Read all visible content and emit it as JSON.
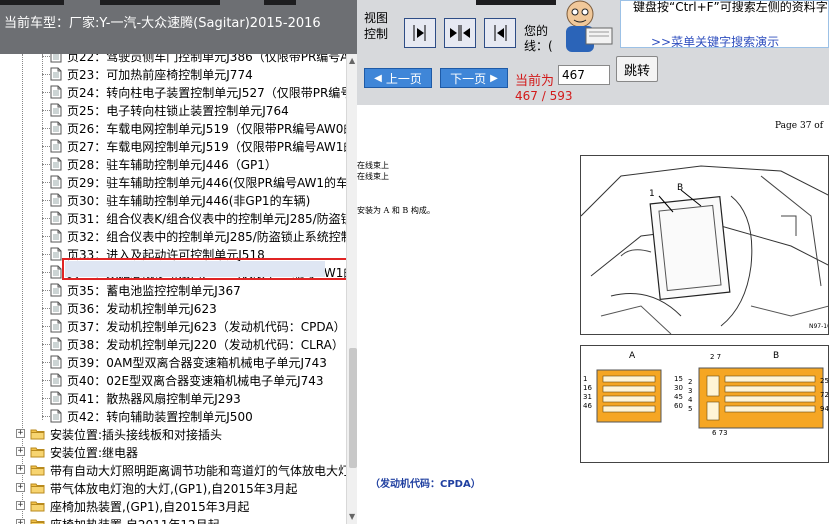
{
  "header": {
    "title": "当前车型：厂家:Y-一汽-大众速腾(Sagitar)2015-2016",
    "view_ctl": "视图控制",
    "tip_partial": "您的\n线：(",
    "help_text": "键盘按“Ctrl+F”可搜索左侧的资料字!",
    "help_link": ">>菜单关键字搜索演示"
  },
  "tree": {
    "pages": [
      {
        "label": "页22：驾驶员侧车门控制单元J386（仅限带PR编号A"
      },
      {
        "label": "页23：可加热前座椅控制单元J774"
      },
      {
        "label": "页24：转向柱电子装置控制单元J527（仅限带PR编号"
      },
      {
        "label": "页25：电子转向柱锁止装置控制单元J764"
      },
      {
        "label": "页26：车载电网控制单元J519（仅限带PR编号AW0的"
      },
      {
        "label": "页27：车载电网控制单元J519（仅限带PR编号AW1的"
      },
      {
        "label": "页28：驻车辅助控制单元J446（GP1）"
      },
      {
        "label": "页29：驻车辅助控制单元J446(仅限PR编号AW1的车"
      },
      {
        "label": "页30：驻车辅助控制单元J446(非GP1的车辆)"
      },
      {
        "label": "页31：组合仪表K/组合仪表中的控制单元J285/防盗锁"
      },
      {
        "label": "页32：组合仪表中的控制单元J285/防盗锁止系统控制"
      },
      {
        "label": "页33：进入及起动许可控制单元J518"
      },
      {
        "label": "页34：数据总线诊断接口J533（仅限带PR编号AW1的"
      },
      {
        "label": "页35：蓄电池监控控制单元J367"
      },
      {
        "label": "页36：发动机控制单元J623"
      },
      {
        "label": "页37：发动机控制单元J623（发动机代码：CPDA）"
      },
      {
        "label": "页38：发动机控制单元J220（发动机代码：CLRA）"
      },
      {
        "label": "页39：0AM型双离合器变速箱机械电子单元J743"
      },
      {
        "label": "页40：02E型双离合器变速箱机械电子单元J743"
      },
      {
        "label": "页41：散热器风扇控制单元J293"
      },
      {
        "label": "页42：转向辅助装置控制单元J500"
      }
    ],
    "folders": [
      {
        "label": "安装位置:插头接线板和对接插头"
      },
      {
        "label": "安装位置:继电器"
      },
      {
        "label": "带有自动大灯照明距离调节功能和弯道灯的气体放电大灯"
      },
      {
        "label": "带气体放电灯泡的大灯,(GP1),自2015年3月起"
      },
      {
        "label": "座椅加热装置,(GP1),自2015年3月起"
      },
      {
        "label": "座椅加热装置,自2011年12月起"
      }
    ]
  },
  "nav": {
    "prev": "上一页",
    "next": "下一页",
    "current_label": "当前为",
    "page_input": "467",
    "jump": "跳转",
    "page_count": "467 / 593"
  },
  "doc": {
    "page_of": "Page 37 of",
    "text1": "在线束上",
    "text2": "在线束上",
    "text3": "发动机代码：CPDA）",
    "text4": "安装为 A 和 B 构成。",
    "caption": "（发动机代码：CPDA）",
    "fig_label_1": "1",
    "fig_label_b": "B",
    "conn_a": "A",
    "conn_b": "B",
    "pins_a_left": [
      "1",
      "16",
      "31",
      "46"
    ],
    "pins_a_right": [
      "15",
      "30",
      "45",
      "60"
    ],
    "pins_b_left": [
      "2",
      "3",
      "4",
      "5"
    ],
    "pins_b_right": [
      "25",
      "72",
      "94"
    ],
    "pins_b_top": [
      "2",
      "7"
    ],
    "pins_b_bottom": "6  73"
  },
  "colors": {
    "accent": "#3f86d8",
    "nav_bg": "#d7d9dc",
    "red": "#d21b1b",
    "connector": "#f5a623"
  }
}
